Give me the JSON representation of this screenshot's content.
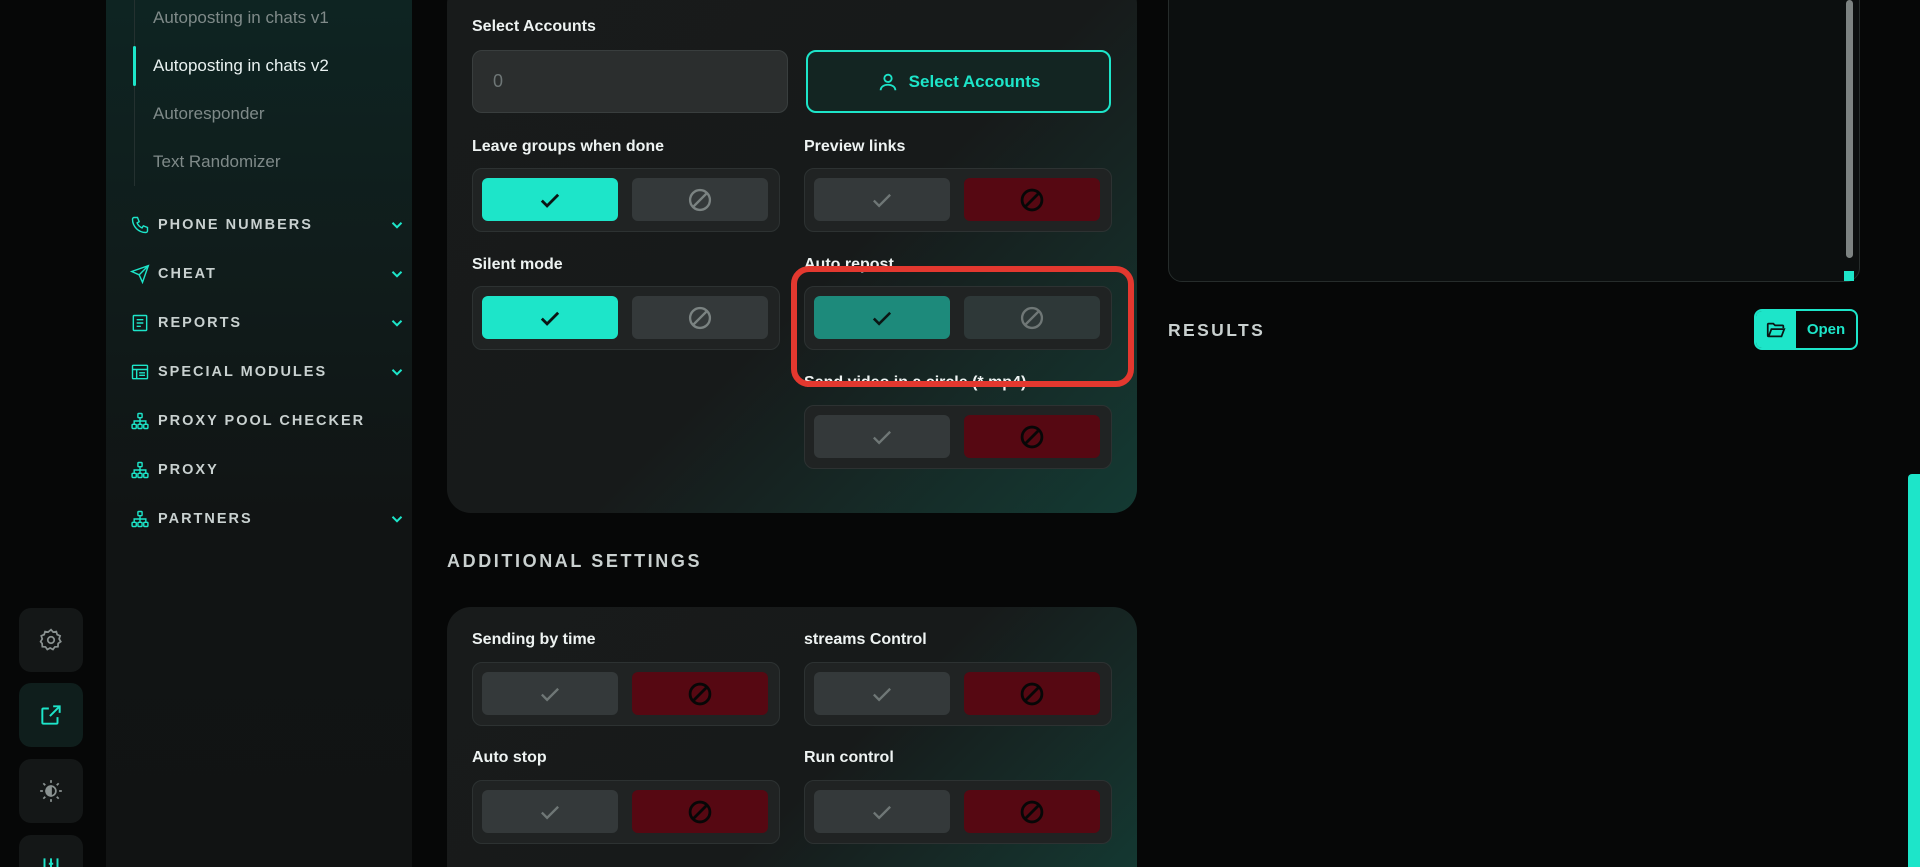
{
  "sidebar": {
    "sub_items": [
      {
        "label": "Autoposting in chats v1"
      },
      {
        "label": "Autoposting in chats v2"
      },
      {
        "label": "Autoresponder"
      },
      {
        "label": "Text Randomizer"
      }
    ],
    "nav": [
      {
        "label": "PHONE NUMBERS",
        "icon": "phone-icon"
      },
      {
        "label": "CHEAT",
        "icon": "send-icon"
      },
      {
        "label": "REPORTS",
        "icon": "report-icon"
      },
      {
        "label": "SPECIAL MODULES",
        "icon": "modules-icon"
      },
      {
        "label": "PROXY POOL CHECKER",
        "icon": "network-icon"
      },
      {
        "label": "PROXY",
        "icon": "network-icon"
      },
      {
        "label": "PARTNERS",
        "icon": "network-icon"
      }
    ]
  },
  "main": {
    "select_accounts": {
      "label": "Select Accounts",
      "count_value": "0",
      "button_label": "Select Accounts"
    },
    "toggles": {
      "leave_groups": {
        "label": "Leave groups when done",
        "value": true
      },
      "preview_links": {
        "label": "Preview links",
        "value": false
      },
      "silent_mode": {
        "label": "Silent mode",
        "value": true
      },
      "auto_repost": {
        "label": "Auto repost",
        "value": true
      },
      "send_video_circle": {
        "label": "Send video in a circle (*.mp4)",
        "value": false
      }
    },
    "additional": {
      "title": "ADDITIONAL SETTINGS",
      "sending_by_time": {
        "label": "Sending by time",
        "value": false
      },
      "streams_control": {
        "label": "streams Control",
        "value": false
      },
      "auto_stop": {
        "label": "Auto stop",
        "value": false
      },
      "run_control": {
        "label": "Run control",
        "value": false
      }
    }
  },
  "results": {
    "title": "RESULTS",
    "open_label": "Open"
  },
  "colors": {
    "accent": "#1de5c9",
    "danger": "#560812",
    "highlight": "#e3382f"
  }
}
